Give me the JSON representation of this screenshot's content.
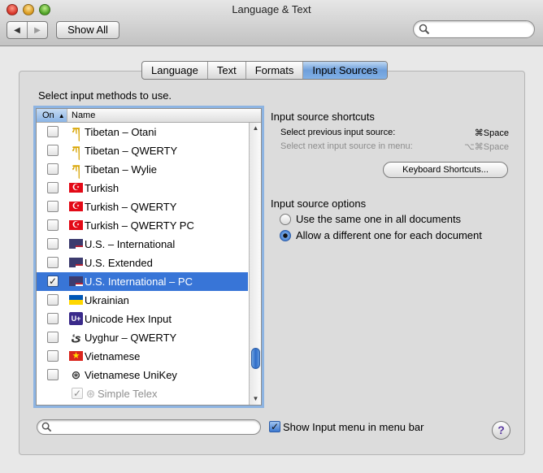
{
  "window": {
    "title": "Language & Text"
  },
  "toolbar": {
    "back_glyph": "◀",
    "forward_glyph": "▶",
    "show_all_label": "Show All",
    "search_value": ""
  },
  "tabs": [
    {
      "label": "Language",
      "active": false
    },
    {
      "label": "Text",
      "active": false
    },
    {
      "label": "Formats",
      "active": false
    },
    {
      "label": "Input Sources",
      "active": true
    }
  ],
  "instructions": "Select input methods to use.",
  "table": {
    "col_on": "On",
    "col_name": "Name",
    "sort_glyph": "▲",
    "rows": [
      {
        "name": "Tibetan – Otani",
        "checked": false,
        "icon": "tibetan-glyph-icon",
        "glyph": "ཀ",
        "color": "#d8a400"
      },
      {
        "name": "Tibetan – QWERTY",
        "checked": false,
        "icon": "tibetan-glyph-icon",
        "glyph": "ཀ",
        "color": "#d8a400"
      },
      {
        "name": "Tibetan – Wylie",
        "checked": false,
        "icon": "tibetan-glyph-icon",
        "glyph": "ཀ",
        "color": "#d8a400"
      },
      {
        "name": "Turkish",
        "checked": false,
        "icon": "turkey-flag-icon",
        "glyph": "☪",
        "color": "#e30a17"
      },
      {
        "name": "Turkish – QWERTY",
        "checked": false,
        "icon": "turkey-flag-icon",
        "glyph": "☪",
        "color": "#e30a17"
      },
      {
        "name": "Turkish – QWERTY PC",
        "checked": false,
        "icon": "turkey-flag-icon",
        "glyph": "☪",
        "color": "#e30a17"
      },
      {
        "name": "U.S. – International",
        "checked": false,
        "icon": "us-flag-icon",
        "glyph": "",
        "color": "#3c3b6e"
      },
      {
        "name": "U.S. Extended",
        "checked": false,
        "icon": "us-flag-icon",
        "glyph": "",
        "color": "#3c3b6e"
      },
      {
        "name": "U.S. International – PC",
        "checked": true,
        "selected": true,
        "icon": "us-flag-icon",
        "glyph": "",
        "color": "#3c3b6e"
      },
      {
        "name": "Ukrainian",
        "checked": false,
        "icon": "ukraine-flag-icon",
        "glyph": "",
        "color": "#0057b7"
      },
      {
        "name": "Unicode Hex Input",
        "checked": false,
        "icon": "unicode-icon",
        "glyph": "U+",
        "color": "#3a2a8a"
      },
      {
        "name": "Uyghur – QWERTY",
        "checked": false,
        "icon": "uyghur-glyph-icon",
        "glyph": "ئ",
        "color": "#333333"
      },
      {
        "name": "Vietnamese",
        "checked": false,
        "icon": "vietnam-flag-icon",
        "glyph": "★",
        "color": "#da251d"
      },
      {
        "name": "Vietnamese UniKey",
        "checked": false,
        "icon": "unikey-icon",
        "glyph": "⊛",
        "color": "#333333"
      },
      {
        "name": "Simple Telex",
        "checked": true,
        "disabled": true,
        "icon": "telex-icon",
        "glyph": "⊛",
        "color": "#888888"
      }
    ],
    "scroll_position": 0.9
  },
  "shortcuts": {
    "heading": "Input source shortcuts",
    "prev_label": "Select previous input source:",
    "prev_key": "⌘Space",
    "next_label": "Select next input source in menu:",
    "next_key": "⌥⌘Space",
    "keyboard_shortcuts_button": "Keyboard Shortcuts..."
  },
  "options": {
    "heading": "Input source options",
    "radio_same": "Use the same one in all documents",
    "radio_different": "Allow a different one for each document",
    "selected": "different"
  },
  "bottom": {
    "search_value": "",
    "show_menu_label": "Show Input menu in menu bar",
    "show_menu_checked": true,
    "help_glyph": "?"
  }
}
